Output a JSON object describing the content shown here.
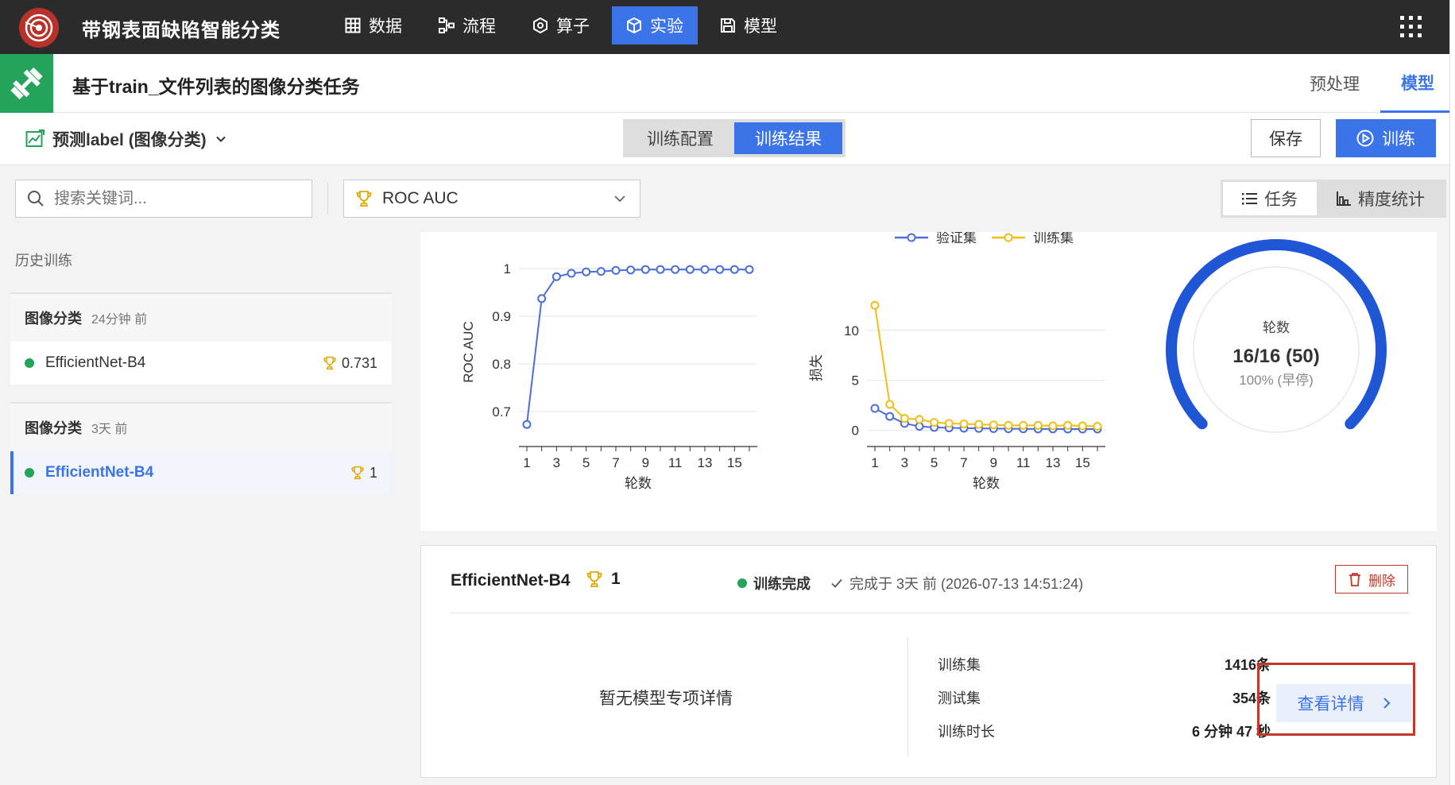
{
  "header": {
    "app_title": "带钢表面缺陷智能分类",
    "nav": [
      {
        "label": "数据",
        "icon": "table-icon",
        "active": false
      },
      {
        "label": "流程",
        "icon": "flow-icon",
        "active": false
      },
      {
        "label": "算子",
        "icon": "operator-icon",
        "active": false
      },
      {
        "label": "实验",
        "icon": "cube-icon",
        "active": true
      },
      {
        "label": "模型",
        "icon": "save-icon",
        "active": false
      }
    ]
  },
  "task": {
    "title": "基于train_文件列表的图像分类任务",
    "tabs": [
      {
        "label": "预处理",
        "active": false
      },
      {
        "label": "模型",
        "active": true
      }
    ]
  },
  "toolbar": {
    "predict_label": "预测label (图像分类)",
    "segment": [
      {
        "label": "训练配置",
        "active": false
      },
      {
        "label": "训练结果",
        "active": true
      }
    ],
    "save_label": "保存",
    "train_label": "训练"
  },
  "filters": {
    "search_placeholder": "搜索关键词...",
    "metric": "ROC AUC",
    "view_tabs": [
      {
        "label": "任务",
        "active": true
      },
      {
        "label": "精度统计",
        "active": false
      }
    ]
  },
  "sidebar": {
    "history_label": "历史训练",
    "groups": [
      {
        "title": "图像分类",
        "time": "24分钟 前",
        "item": {
          "name": "EfficientNet-B4",
          "score": "0.731",
          "selected": false
        }
      },
      {
        "title": "图像分类",
        "time": "3天 前",
        "item": {
          "name": "EfficientNet-B4",
          "score": "1",
          "selected": true
        }
      }
    ]
  },
  "chart_data": [
    {
      "type": "line",
      "ylabel": "ROC AUC",
      "xlabel": "轮数",
      "x": [
        1,
        2,
        3,
        4,
        5,
        6,
        7,
        8,
        9,
        10,
        11,
        12,
        13,
        14,
        15,
        16
      ],
      "series": [
        {
          "name": "",
          "color": "#4a6fd8",
          "values": [
            0.673,
            0.937,
            0.983,
            0.99,
            0.993,
            0.994,
            0.996,
            0.997,
            0.998,
            0.998,
            0.998,
            0.998,
            0.998,
            0.998,
            0.998,
            0.998
          ]
        }
      ],
      "ylim": [
        0.65,
        1.0
      ],
      "yticks": [
        "0.7",
        "0.8",
        "0.9",
        "1"
      ],
      "xticks": [
        "1",
        "3",
        "5",
        "7",
        "9",
        "11",
        "13",
        "15"
      ],
      "grid": true
    },
    {
      "type": "line",
      "ylabel": "损失",
      "xlabel": "轮数",
      "x": [
        1,
        2,
        3,
        4,
        5,
        6,
        7,
        8,
        9,
        10,
        11,
        12,
        13,
        14,
        15,
        16
      ],
      "series": [
        {
          "name": "验证集",
          "color": "#4a6fd8",
          "values": [
            2.2,
            1.4,
            0.7,
            0.4,
            0.3,
            0.25,
            0.22,
            0.2,
            0.18,
            0.17,
            0.16,
            0.15,
            0.15,
            0.14,
            0.14,
            0.14
          ]
        },
        {
          "name": "训练集",
          "color": "#f0be14",
          "values": [
            12.5,
            2.6,
            1.2,
            1.1,
            0.8,
            0.7,
            0.65,
            0.6,
            0.55,
            0.5,
            0.5,
            0.5,
            0.45,
            0.5,
            0.45,
            0.4
          ]
        }
      ],
      "ylim": [
        -0.5,
        13
      ],
      "yticks": [
        "0",
        "5",
        "10"
      ],
      "xticks": [
        "1",
        "3",
        "5",
        "7",
        "9",
        "11",
        "13",
        "15"
      ],
      "legend": "top",
      "grid": true
    }
  ],
  "gauge": {
    "label": "轮数",
    "value": "16/16 (50)",
    "sub": "100% (早停)",
    "fraction": 1.0,
    "color": "#1f56d6"
  },
  "detail": {
    "name": "EfficientNet-B4",
    "score": "1",
    "status": "训练完成",
    "done_text": "完成于 3天 前 (2026-07-13 14:51:24)",
    "delete_label": "删除",
    "no_detail": "暂无模型专项详情",
    "stats": [
      {
        "label": "训练集",
        "value": "1416条"
      },
      {
        "label": "测试集",
        "value": "354条"
      },
      {
        "label": "训练时长",
        "value": "6 分钟 47 秒"
      }
    ],
    "view_label": "查看详情"
  }
}
